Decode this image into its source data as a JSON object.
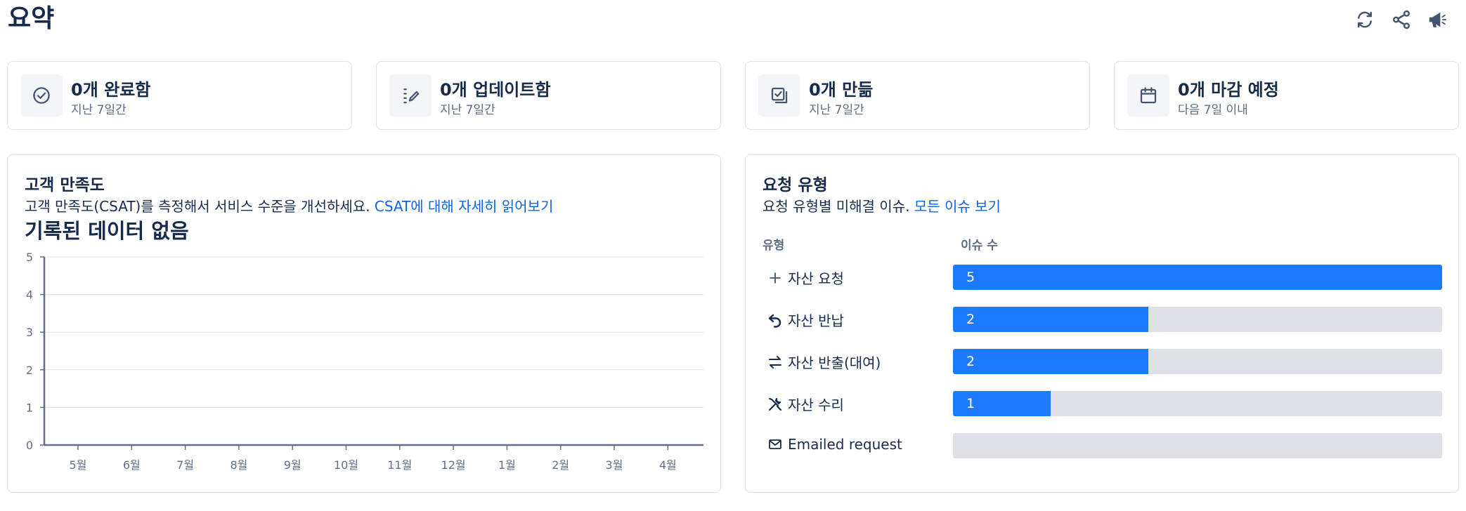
{
  "page": {
    "title": "요약"
  },
  "actions": [
    {
      "name": "refresh-icon",
      "label": "refresh"
    },
    {
      "name": "share-icon",
      "label": "share"
    },
    {
      "name": "feedback-megaphone-icon",
      "label": "feedback"
    }
  ],
  "stats": [
    {
      "icon": "check-circle-icon",
      "title": "0개 완료함",
      "subtitle": "지난 7일간"
    },
    {
      "icon": "edit-list-icon",
      "title": "0개 업데이트함",
      "subtitle": "지난 7일간"
    },
    {
      "icon": "created-checkbox-icon",
      "title": "0개 만듦",
      "subtitle": "지난 7일간"
    },
    {
      "icon": "calendar-icon",
      "title": "0개 마감 예정",
      "subtitle": "다음 7일 이내"
    }
  ],
  "csat": {
    "title": "고객 만족도",
    "description": "고객 만족도(CSAT)를 측정해서 서비스 수준을 개선하세요.",
    "link_text": "CSAT에 대해 자세히 읽어보기",
    "empty_text": "기록된 데이터 없음"
  },
  "chart_data": {
    "type": "line",
    "title": "",
    "xlabel": "",
    "ylabel": "",
    "categories": [
      "5월",
      "6월",
      "7월",
      "8월",
      "9월",
      "10월",
      "11월",
      "12월",
      "1월",
      "2월",
      "3월",
      "4월"
    ],
    "y_ticks": [
      "0",
      "1",
      "2",
      "3",
      "4",
      "5"
    ],
    "ylim": [
      0,
      5
    ],
    "grid": true,
    "series": []
  },
  "request_types": {
    "title": "요청 유형",
    "description": "요청 유형별 미해결 이슈.",
    "link_text": "모든 이슈 보기",
    "col_type": "유형",
    "col_count": "이슈 수",
    "max_value": 5,
    "bar_color": "#1d7afc",
    "track_color": "#dfe1e6",
    "rows": [
      {
        "icon": "plus-icon",
        "label": "자산 요청",
        "count": 5,
        "count_label": "5"
      },
      {
        "icon": "return-arrow-icon",
        "label": "자산 반납",
        "count": 2,
        "count_label": "2"
      },
      {
        "icon": "swap-arrows-icon",
        "label": "자산 반출(대여)",
        "count": 2,
        "count_label": "2"
      },
      {
        "icon": "tools-icon",
        "label": "자산 수리",
        "count": 1,
        "count_label": "1"
      },
      {
        "icon": "envelope-icon",
        "label": "Emailed request",
        "count": 0,
        "count_label": ""
      }
    ]
  }
}
